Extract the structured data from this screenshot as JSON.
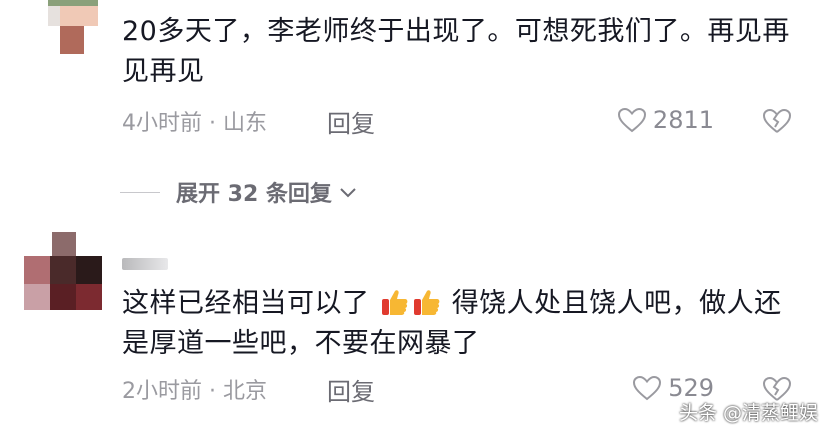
{
  "comments": [
    {
      "text": "20多天了，李老师终于出现了。可想死我们了。再见再见再见",
      "time_location": "4小时前 · 山东",
      "reply_label": "回复",
      "likes": "2811",
      "expand_label": "展开 32 条回复"
    },
    {
      "text_part1": "这样已经相当可以了",
      "text_part2": "得饶人处且饶人吧，做人还是厚道一些吧，不要在网暴了",
      "time_location": "2小时前 · 北京",
      "reply_label": "回复",
      "likes": "529"
    }
  ],
  "watermark": "头条 @清蒸鲤娱",
  "icons": [
    "heart-outline-icon",
    "broken-heart-icon",
    "chevron-down-icon",
    "thumbs-up-emoji"
  ]
}
